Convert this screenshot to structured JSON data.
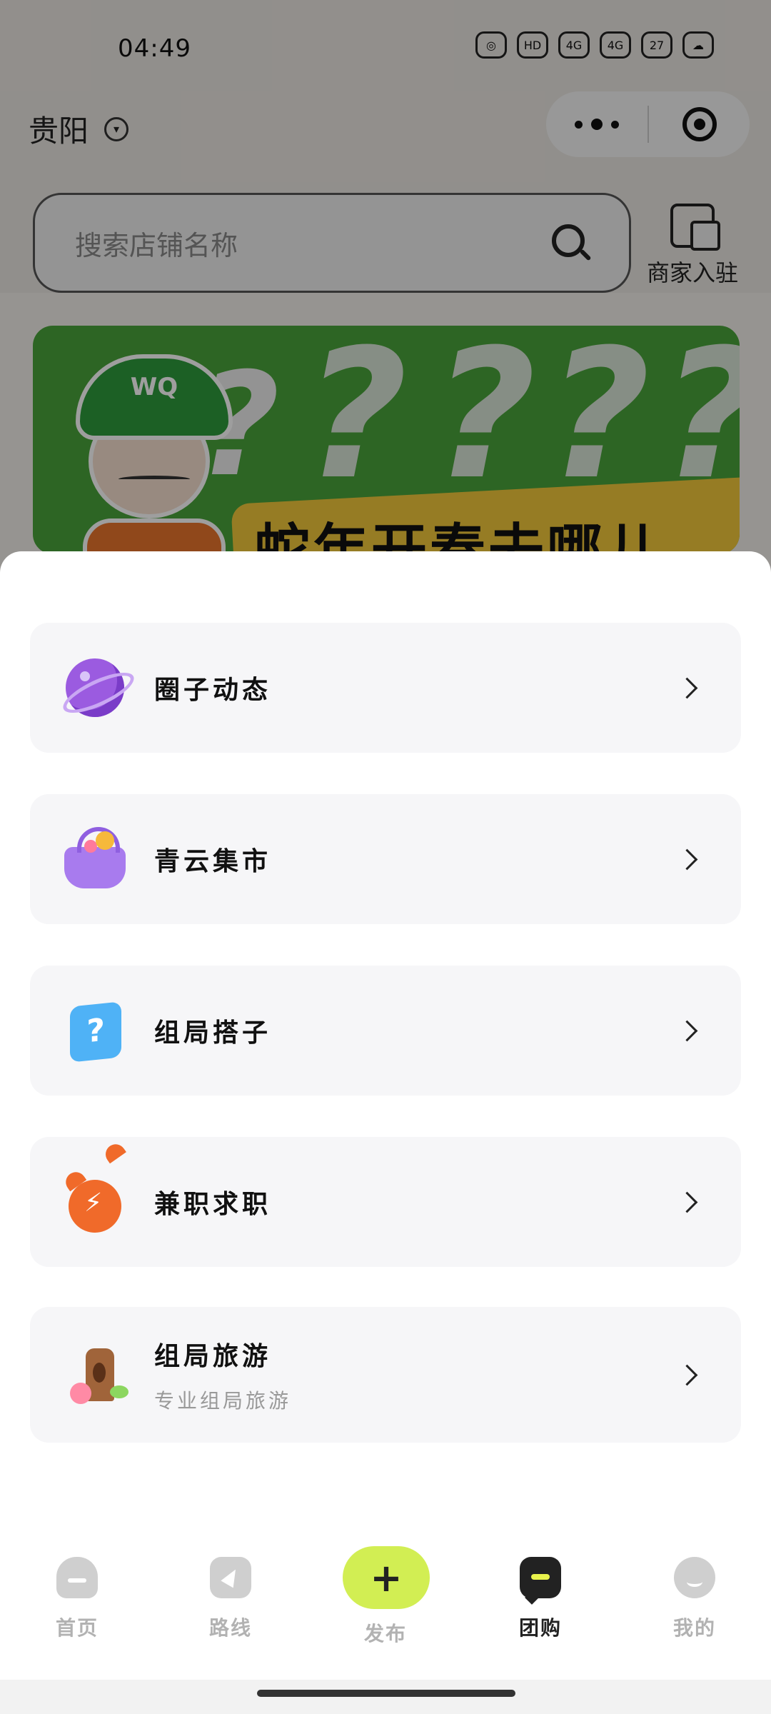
{
  "status_bar": {
    "time": "04:49",
    "icons": [
      "wifi-icon",
      "hd-icon",
      "4g-signal-icon",
      "4g-signal-icon",
      "battery-icon",
      "cloud-icon"
    ],
    "battery": "27"
  },
  "header": {
    "city": "贵阳",
    "search_placeholder": "搜索店铺名称",
    "merchant_label": "商家入驻"
  },
  "banner": {
    "cap_text": "WQ",
    "headline": "蛇年开春去哪儿玩?",
    "colors": {
      "bg": "#4aa43a",
      "strip": "#f3c83a"
    }
  },
  "sheet": {
    "items": [
      {
        "title": "圈子动态",
        "icon": "planet-icon"
      },
      {
        "title": "青云集市",
        "icon": "basket-icon"
      },
      {
        "title": "组局搭子",
        "icon": "question-cube-icon"
      },
      {
        "title": "兼职求职",
        "icon": "alarm-clock-icon"
      },
      {
        "title": "组局旅游",
        "subtitle": "专业组局旅游",
        "icon": "tree-trunk-icon"
      }
    ]
  },
  "tabbar": {
    "tabs": [
      {
        "label": "首页",
        "icon": "home-icon"
      },
      {
        "label": "路线",
        "icon": "route-icon"
      },
      {
        "label": "发布",
        "icon": "plus-icon"
      },
      {
        "label": "团购",
        "icon": "chat-icon",
        "active": true
      },
      {
        "label": "我的",
        "icon": "smile-icon"
      }
    ],
    "publish_symbol": "+",
    "accent": "#d2ee53"
  }
}
